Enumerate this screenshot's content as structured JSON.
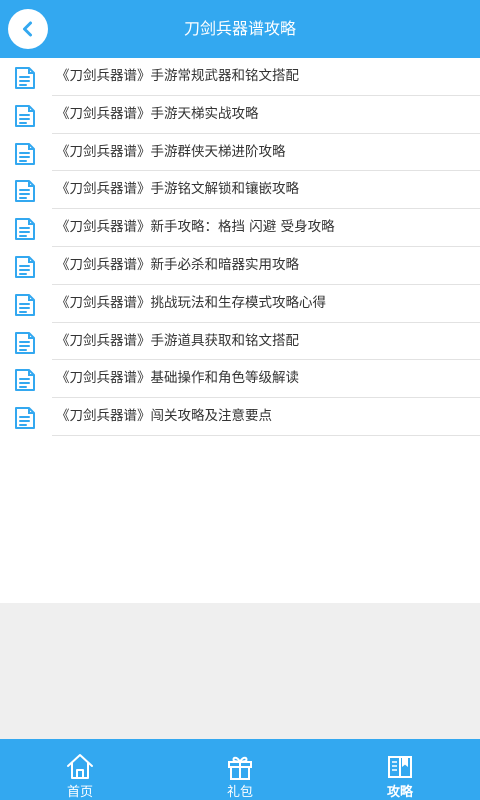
{
  "header": {
    "title": "刀剑兵器谱攻略",
    "back_icon": "chevron-left-icon"
  },
  "articles": [
    {
      "title": "《刀剑兵器谱》手游常规武器和铭文搭配"
    },
    {
      "title": "《刀剑兵器谱》手游天梯实战攻略"
    },
    {
      "title": "《刀剑兵器谱》手游群侠天梯进阶攻略"
    },
    {
      "title": "《刀剑兵器谱》手游铭文解锁和镶嵌攻略"
    },
    {
      "title": "《刀剑兵器谱》新手攻略：格挡 闪避 受身攻略"
    },
    {
      "title": "《刀剑兵器谱》新手必杀和暗器实用攻略"
    },
    {
      "title": "《刀剑兵器谱》挑战玩法和生存模式攻略心得"
    },
    {
      "title": "《刀剑兵器谱》手游道具获取和铭文搭配"
    },
    {
      "title": "《刀剑兵器谱》基础操作和角色等级解读"
    },
    {
      "title": "《刀剑兵器谱》闯关攻略及注意要点"
    }
  ],
  "tabs": [
    {
      "label": "首页",
      "icon": "home-icon",
      "active": false
    },
    {
      "label": "礼包",
      "icon": "gift-icon",
      "active": false
    },
    {
      "label": "攻略",
      "icon": "book-icon",
      "active": true
    }
  ],
  "colors": {
    "primary": "#33a8f0",
    "text": "#333333",
    "background": "#efefef",
    "divider": "#e2e2e2"
  }
}
